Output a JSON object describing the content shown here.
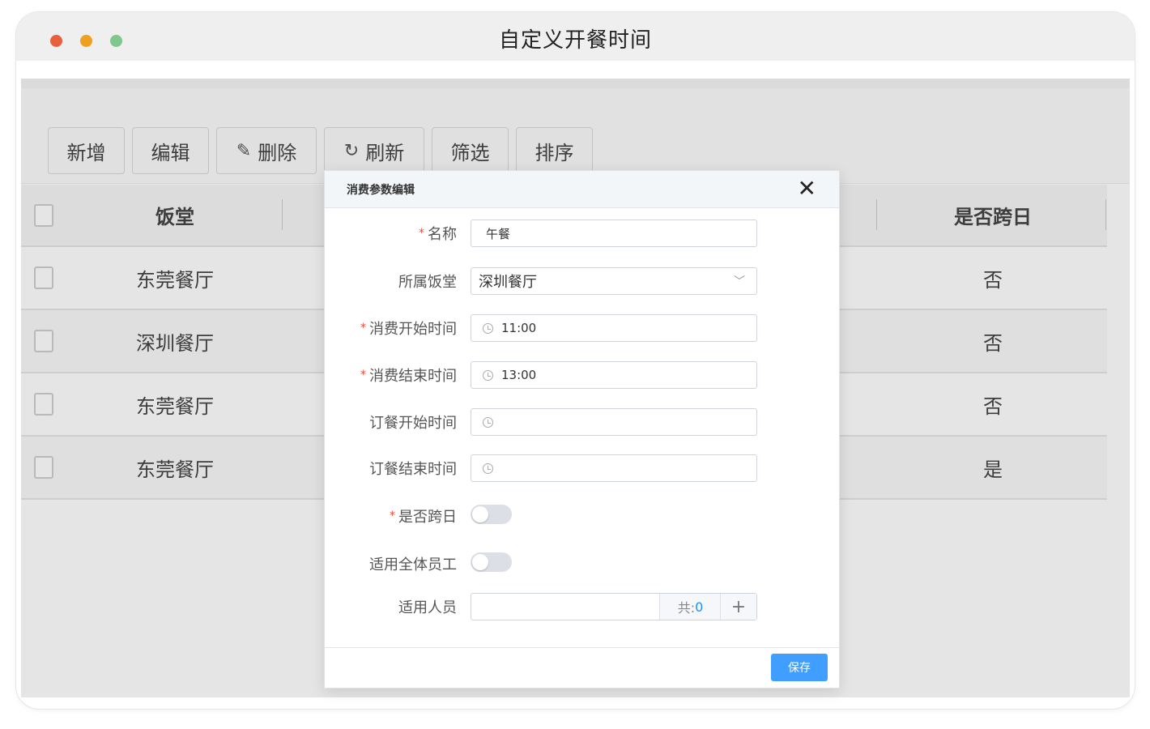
{
  "window": {
    "title": "自定义开餐时间"
  },
  "toolbar": {
    "add_label": "新增",
    "edit_label": "编辑",
    "delete_label": "删除",
    "refresh_label": "刷新",
    "filter_label": "筛选",
    "sort_label": "排序"
  },
  "grid": {
    "columns": {
      "hall": "饭堂",
      "cross_day": "是否跨日"
    },
    "rows": [
      {
        "hall": "东莞餐厅",
        "cross_day": "否"
      },
      {
        "hall": "深圳餐厅",
        "cross_day": "否"
      },
      {
        "hall": "东莞餐厅",
        "cross_day": "否"
      },
      {
        "hall": "东莞餐厅",
        "cross_day": "是"
      }
    ]
  },
  "dialog": {
    "title": "消费参数编辑",
    "close_icon": "close-icon",
    "fields": {
      "name_label": "名称",
      "name_value": "午餐",
      "hall_label": "所属饭堂",
      "hall_value": "深圳餐厅",
      "consume_start_label": "消费开始时间",
      "consume_start_value": "11:00",
      "consume_end_label": "消费结束时间",
      "consume_end_value": "13:00",
      "order_start_label": "订餐开始时间",
      "order_start_value": "",
      "order_end_label": "订餐结束时间",
      "order_end_value": "",
      "cross_day_label": "是否跨日",
      "cross_day_on": false,
      "all_staff_label": "适用全体员工",
      "all_staff_on": false,
      "people_label": "适用人员",
      "people_count_prefix": "共:",
      "people_count": "0",
      "people_add": "+"
    },
    "save_label": "保存"
  },
  "colors": {
    "primary": "#409eff",
    "required": "#e74c3c",
    "dot_red": "#e9603f",
    "dot_yellow": "#f0a020",
    "dot_green": "#7fc88c"
  }
}
